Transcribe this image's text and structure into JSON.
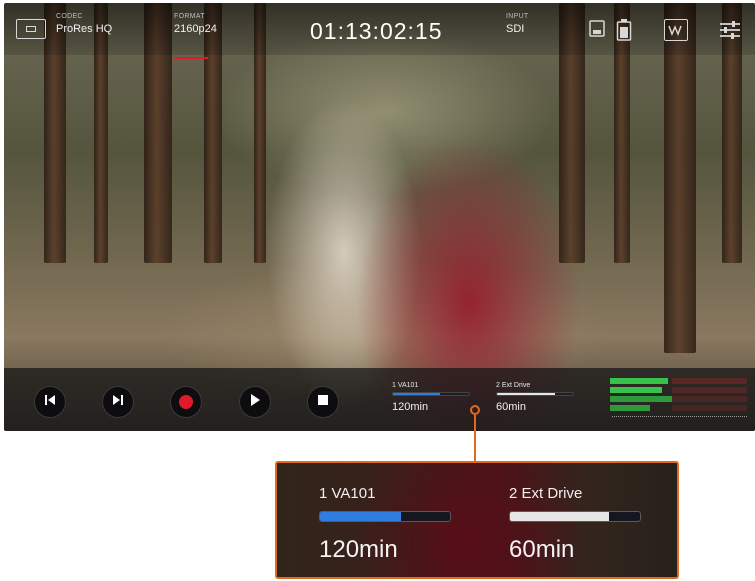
{
  "topbar": {
    "codec_caption": "CODEC",
    "codec": "ProRes HQ",
    "format_caption": "FORMAT",
    "format": "2160p24",
    "timecode": "01:13:02:15",
    "input_caption": "INPUT",
    "input": "SDI",
    "icons": [
      "monitor-icon",
      "battery-icon",
      "waveform-icon",
      "settings-sliders-icon"
    ]
  },
  "transport": {
    "buttons": [
      "skip-back",
      "skip-forward",
      "record",
      "play",
      "stop"
    ],
    "record_color": "#e01a2b"
  },
  "media": [
    {
      "label": "1  VA101",
      "remaining": "120min",
      "fill": 0.62,
      "color": "#2f7de0"
    },
    {
      "label": "2  Ext Drive",
      "remaining": "60min",
      "fill": 0.76,
      "color": "#e6e6e6"
    }
  ],
  "callout": {
    "accent": "#e06a1f",
    "slot1_label": "1  VA101",
    "slot1_time": "120min",
    "slot2_label": "2  Ext Drive",
    "slot2_time": "60min"
  }
}
